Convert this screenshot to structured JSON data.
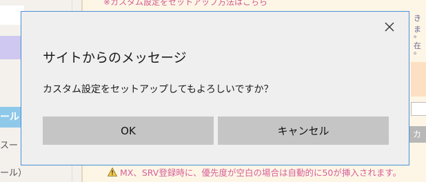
{
  "background": {
    "top_link": "※カスタム設定をセットアップ方法はこちら",
    "tool_heading": "ール",
    "left_text_1": "スー",
    "left_text_2": "ール）",
    "right_text_1": "きま",
    "right_text_2": "。在",
    "right_text_3": "。",
    "side_button": "カ",
    "warning_text": "MX、SRV登録時に、優先度が空白の場合は自動的に50が挿入されます。"
  },
  "dialog": {
    "title": "サイトからのメッセージ",
    "message": "カスタム設定をセットアップしてもよろしいですか？",
    "ok_label": "OK",
    "cancel_label": "キャンセル"
  },
  "colors": {
    "dialog_border": "#4a8fd6",
    "dialog_bg": "#efefef",
    "button_bg": "#c5c5c5",
    "warning_text": "#d6609a"
  },
  "icons": {
    "close": "close-icon",
    "warning": "warning-icon"
  }
}
